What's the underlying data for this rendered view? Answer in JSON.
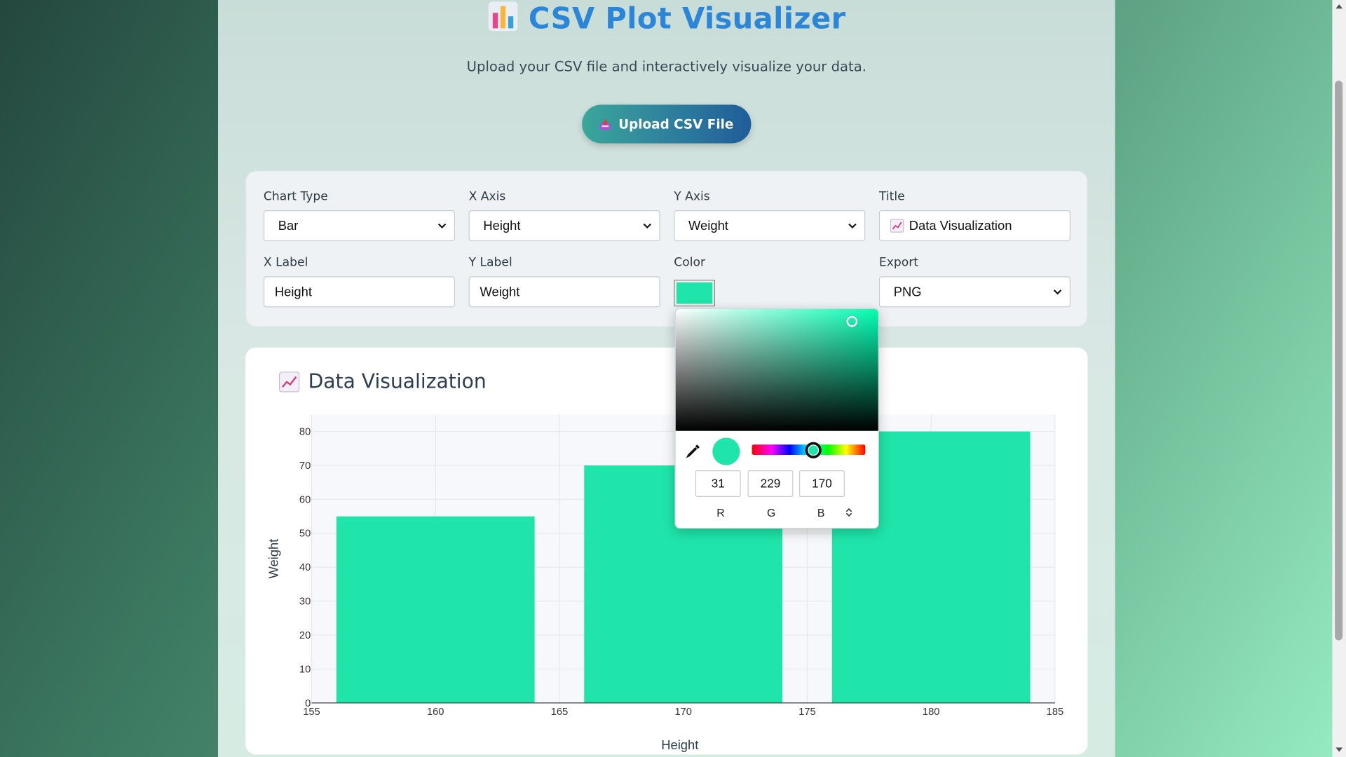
{
  "header": {
    "title": "CSV Plot Visualizer",
    "title_icon": "bar-chart-icon",
    "subtitle": "Upload your CSV file and interactively visualize your data.",
    "upload_label": "Upload CSV File",
    "upload_icon": "inbox-tray-icon"
  },
  "controls": {
    "chart_type": {
      "label": "Chart Type",
      "value": "Bar"
    },
    "x_axis": {
      "label": "X Axis",
      "value": "Height"
    },
    "y_axis": {
      "label": "Y Axis",
      "value": "Weight"
    },
    "title": {
      "label": "Title",
      "value": "Data Visualization"
    },
    "x_label": {
      "label": "X Label",
      "value": "Height"
    },
    "y_label": {
      "label": "Y Label",
      "value": "Weight"
    },
    "color": {
      "label": "Color",
      "value": "#1fe5aa"
    },
    "export": {
      "label": "Export",
      "value": "PNG"
    }
  },
  "color_picker": {
    "r": "31",
    "g": "229",
    "b": "170",
    "r_label": "R",
    "g_label": "G",
    "b_label": "B",
    "color": "#1fe5aa"
  },
  "chart_heading": "Data Visualization",
  "chart_data": {
    "type": "bar",
    "x": [
      160,
      170,
      180
    ],
    "values": [
      55,
      70,
      80
    ],
    "bar_width": 8,
    "xlabel": "Height",
    "ylabel": "Weight",
    "xlim": [
      155,
      185
    ],
    "ylim": [
      0,
      85
    ],
    "xticks": [
      155,
      160,
      165,
      170,
      175,
      180,
      185
    ],
    "yticks": [
      0,
      10,
      20,
      30,
      40,
      50,
      60,
      70,
      80
    ],
    "grid": true,
    "color": "#1fe5aa"
  }
}
